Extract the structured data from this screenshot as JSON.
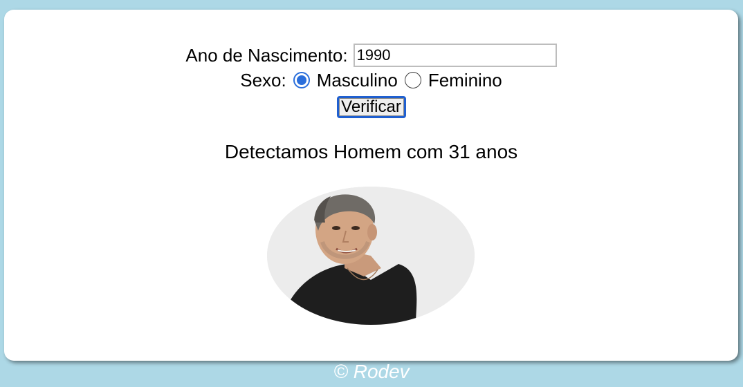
{
  "form": {
    "ano_label": "Ano de Nascimento:",
    "ano_value": "1990",
    "sexo_label": "Sexo:",
    "options": [
      {
        "label": "Masculino",
        "checked": true
      },
      {
        "label": "Feminino",
        "checked": false
      }
    ],
    "button_label": "Verificar"
  },
  "result": {
    "text": "Detectamos Homem com 31 anos"
  },
  "footer": {
    "text": "© Rodev"
  },
  "colors": {
    "background": "#add8e6",
    "card": "#ffffff",
    "accent": "#2a6edb"
  },
  "icons": {
    "photo": "man-photo"
  }
}
